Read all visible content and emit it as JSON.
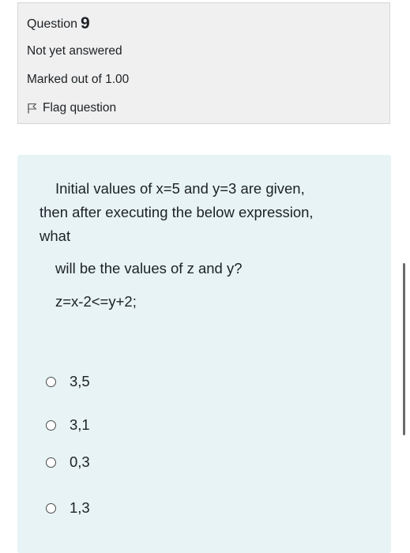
{
  "info": {
    "question_word": "Question",
    "question_number": "9",
    "state": "Not yet answered",
    "grade": "Marked out of 1.00",
    "flag_label": "Flag question",
    "flag_icon": "flag-icon"
  },
  "question": {
    "line1": "Initial values of x=5 and y=3 are given,",
    "line2": "then after executing the below expression,",
    "line3": "what",
    "line4": "will be the values of z and y?",
    "expression": "z=x-2<=y+2;"
  },
  "options": [
    {
      "label": "3,5",
      "selected": false
    },
    {
      "label": "3,1",
      "selected": false
    },
    {
      "label": "0,3",
      "selected": false
    },
    {
      "label": "1,3",
      "selected": false
    }
  ],
  "colors": {
    "info_background": "#f0f0f0",
    "content_background": "#e7f3f5",
    "text": "#1d2125"
  }
}
